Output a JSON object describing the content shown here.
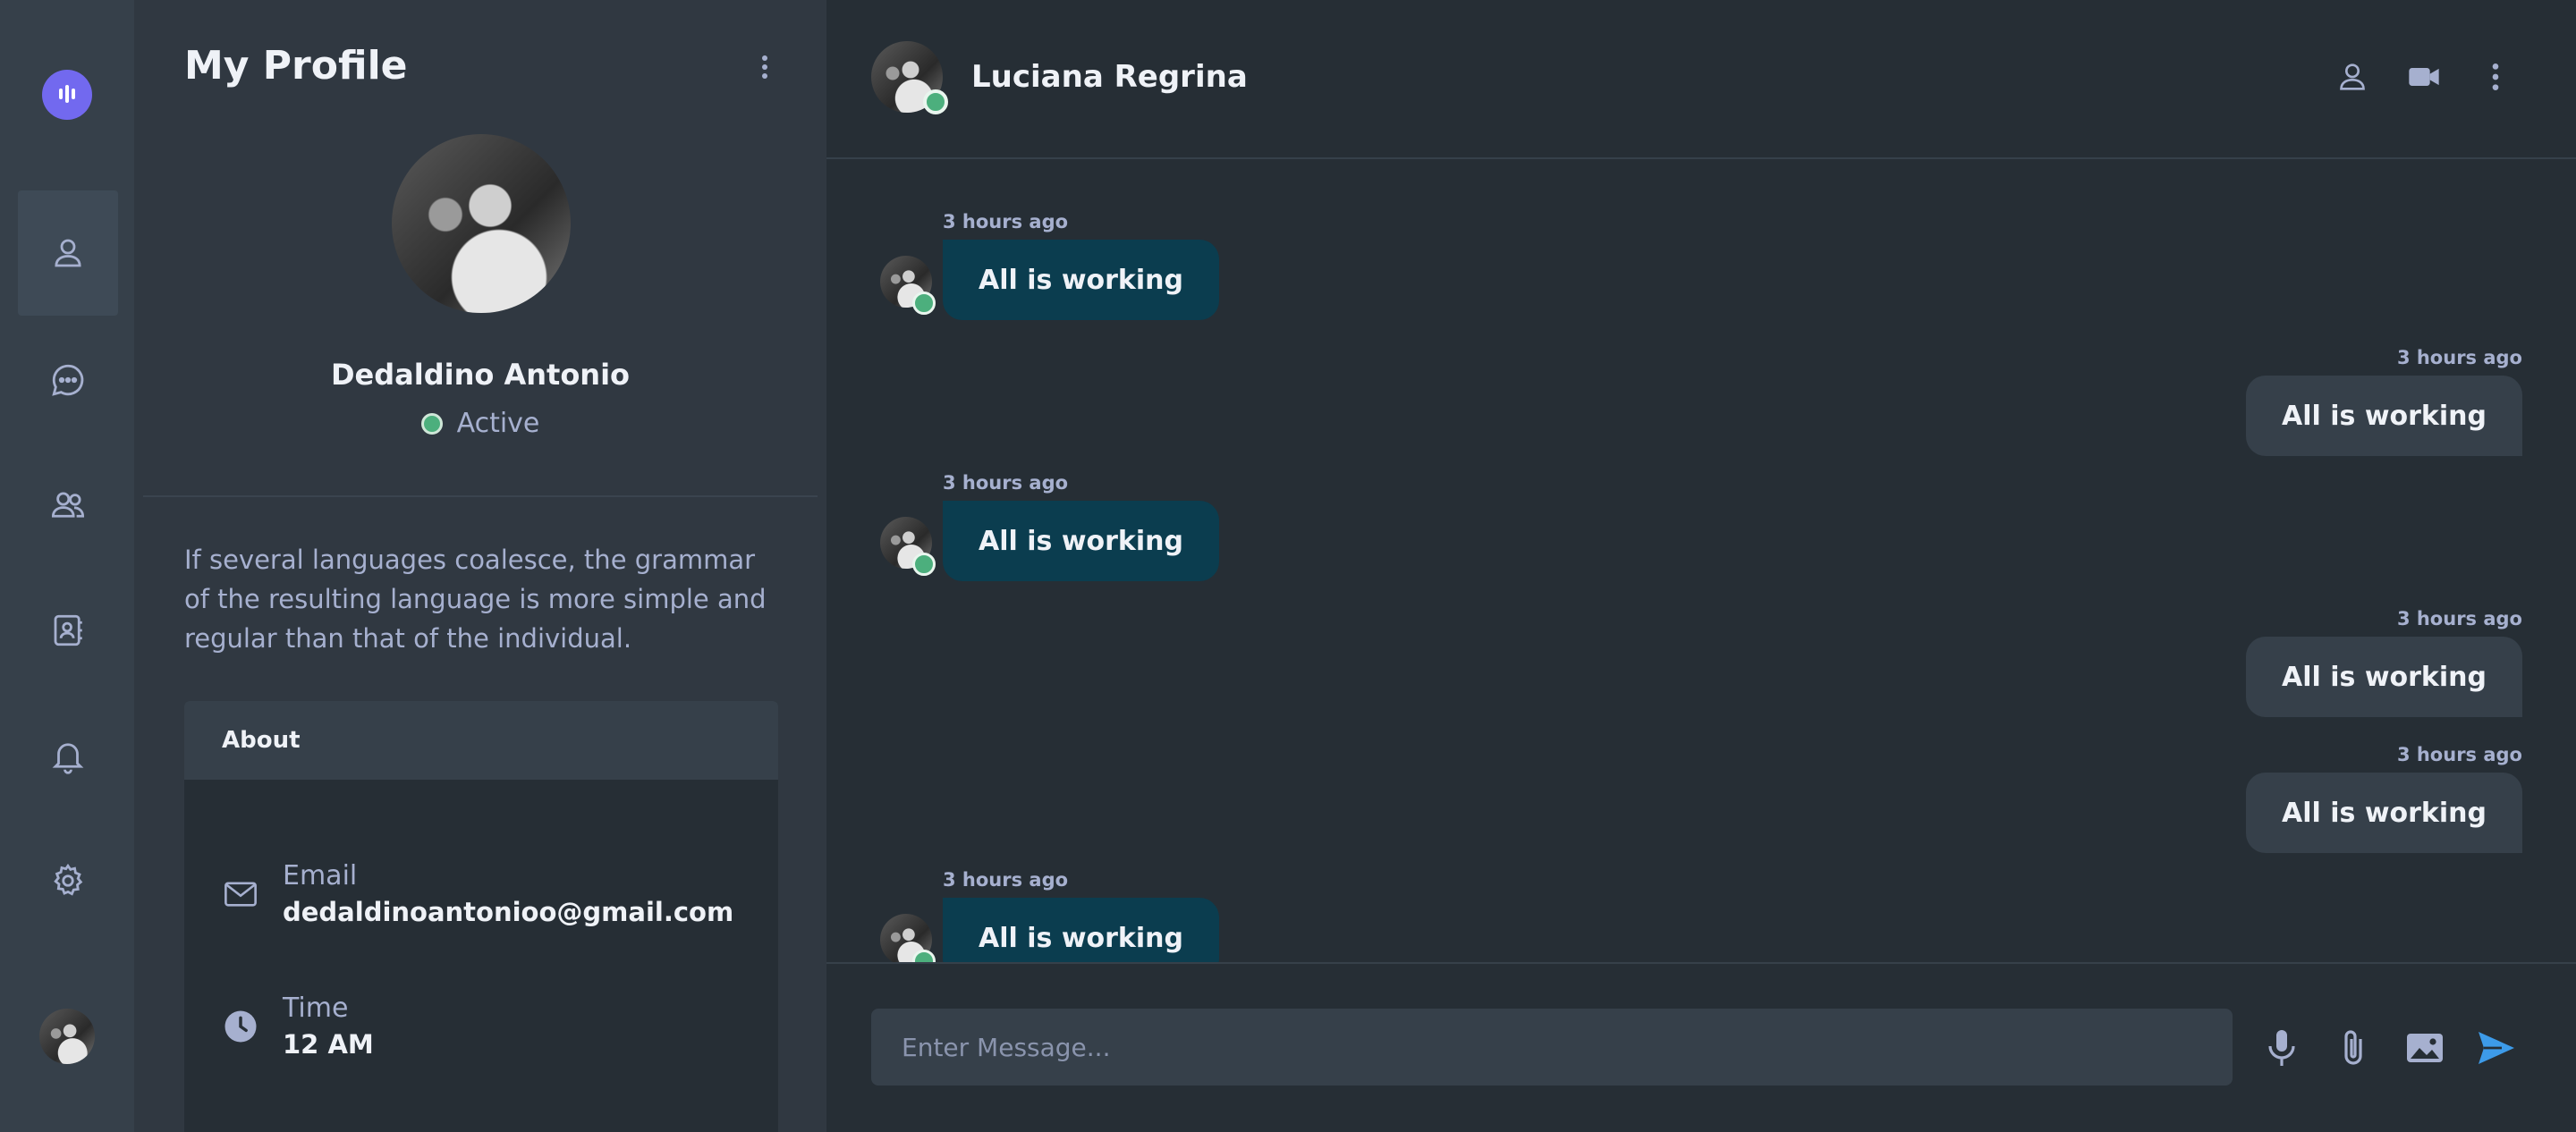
{
  "app": {
    "accent_color": "#7269ef",
    "online_color": "#4caf7d"
  },
  "rail": {
    "logo_icon": "chat-logo-icon",
    "items": [
      {
        "icon": "user-icon",
        "active": true
      },
      {
        "icon": "chat-bubble-icon",
        "active": false
      },
      {
        "icon": "users-icon",
        "active": false
      },
      {
        "icon": "contacts-icon",
        "active": false
      },
      {
        "icon": "bell-icon",
        "active": false
      },
      {
        "icon": "gear-icon",
        "active": false
      }
    ]
  },
  "profile": {
    "title": "My Profile",
    "name": "Dedaldino Antonio",
    "status": "Active",
    "bio": "If several languages coalesce, the grammar of the resulting language is more simple and regular than that of the individual.",
    "about_title": "About",
    "email_label": "Email",
    "email_value": "dedaldinoantonioo@gmail.com",
    "time_label": "Time",
    "time_value": "12 AM"
  },
  "chat": {
    "contact_name": "Luciana Regrina",
    "messages": [
      {
        "direction": "in",
        "time": "3 hours ago",
        "text": "All is working"
      },
      {
        "direction": "out",
        "time": "3 hours ago",
        "text": "All is working"
      },
      {
        "direction": "in",
        "time": "3 hours ago",
        "text": "All is working"
      },
      {
        "direction": "out",
        "time": "3 hours ago",
        "text": "All is working"
      },
      {
        "direction": "out",
        "time": "3 hours ago",
        "text": "All is working"
      },
      {
        "direction": "in",
        "time": "3 hours ago",
        "text": "All is working"
      }
    ],
    "composer": {
      "placeholder": "Enter Message...",
      "value": ""
    }
  }
}
